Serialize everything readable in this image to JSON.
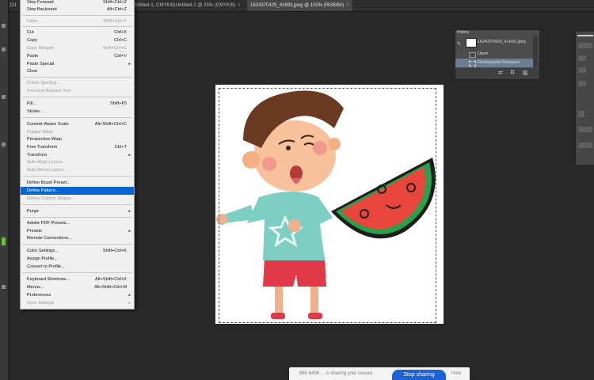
{
  "tabs": [
    {
      "label": "Untitled-1, CMYK/8)",
      "close": "×"
    },
    {
      "label": "Untitled-2 @ 25% (CMYK/8)",
      "close": "×"
    },
    {
      "label": "1624370429_41692.jpeg @ 100% (RGB/8#)",
      "close": "×"
    }
  ],
  "tab_left_fragment": "111",
  "edit_menu": {
    "items": [
      {
        "label": "Step Forward",
        "shortcut": "Shift+Ctrl+Z",
        "disabled": false
      },
      {
        "label": "Step Backward",
        "shortcut": "Alt+Ctrl+Z",
        "disabled": false
      },
      {
        "label": "Fade...",
        "shortcut": "Shift+Ctrl+F",
        "disabled": true
      },
      {
        "label": "Cut",
        "shortcut": "Ctrl+X",
        "disabled": false
      },
      {
        "label": "Copy",
        "shortcut": "Ctrl+C",
        "disabled": false
      },
      {
        "label": "Copy Merged",
        "shortcut": "Shift+Ctrl+C",
        "disabled": true
      },
      {
        "label": "Paste",
        "shortcut": "Ctrl+V",
        "disabled": false
      },
      {
        "label": "Paste Special",
        "shortcut": "",
        "disabled": false,
        "submenu": true
      },
      {
        "label": "Clear",
        "shortcut": "",
        "disabled": false
      },
      {
        "label": "Check Spelling...",
        "shortcut": "",
        "disabled": true
      },
      {
        "label": "Find and Replace Text...",
        "shortcut": "",
        "disabled": true
      },
      {
        "label": "Fill...",
        "shortcut": "Shift+F5",
        "disabled": false
      },
      {
        "label": "Stroke...",
        "shortcut": "",
        "disabled": false
      },
      {
        "label": "Content-Aware Scale",
        "shortcut": "Alt+Shift+Ctrl+C",
        "disabled": false
      },
      {
        "label": "Puppet Warp",
        "shortcut": "",
        "disabled": true
      },
      {
        "label": "Perspective Warp",
        "shortcut": "",
        "disabled": false
      },
      {
        "label": "Free Transform",
        "shortcut": "Ctrl+T",
        "disabled": false
      },
      {
        "label": "Transform",
        "shortcut": "",
        "disabled": false,
        "submenu": true
      },
      {
        "label": "Auto-Align Layers...",
        "shortcut": "",
        "disabled": true
      },
      {
        "label": "Auto-Blend Layers...",
        "shortcut": "",
        "disabled": true
      },
      {
        "label": "Define Brush Preset...",
        "shortcut": "",
        "disabled": false
      },
      {
        "label": "Define Pattern...",
        "shortcut": "",
        "disabled": false,
        "highlighted": true
      },
      {
        "label": "Define Custom Shape...",
        "shortcut": "",
        "disabled": true
      },
      {
        "label": "Purge",
        "shortcut": "",
        "disabled": false,
        "submenu": true
      },
      {
        "label": "Adobe PDF Presets...",
        "shortcut": "",
        "disabled": false
      },
      {
        "label": "Presets",
        "shortcut": "",
        "disabled": false,
        "submenu": true
      },
      {
        "label": "Remote Connections...",
        "shortcut": "",
        "disabled": false
      },
      {
        "label": "Color Settings...",
        "shortcut": "Shift+Ctrl+K",
        "disabled": false
      },
      {
        "label": "Assign Profile...",
        "shortcut": "",
        "disabled": false
      },
      {
        "label": "Convert to Profile...",
        "shortcut": "",
        "disabled": false
      },
      {
        "label": "Keyboard Shortcuts...",
        "shortcut": "Alt+Shift+Ctrl+K",
        "disabled": false
      },
      {
        "label": "Menus...",
        "shortcut": "Alt+Shift+Ctrl+M",
        "disabled": false
      },
      {
        "label": "Preferences",
        "shortcut": "",
        "disabled": false,
        "submenu": true
      },
      {
        "label": "Sync Settings",
        "shortcut": "",
        "disabled": true,
        "submenu": true
      }
    ],
    "submenu_arrow": "▸"
  },
  "history_panel": {
    "title": "History",
    "snapshot_label": "1624370429_41692.jpeg",
    "steps": [
      "Open",
      "Rectangular Marquee"
    ]
  },
  "notification": {
    "text": "885 6406 ... is sharing your screen.",
    "button_label": "Stop sharing",
    "more_label": "Hide"
  },
  "colors": {
    "menu_highlight": "#0a64d2",
    "watermelon_red": "#e8453c",
    "watermelon_green": "#2aa04a",
    "shirt": "#7ccfc2",
    "shorts": "#e03a4a",
    "hair": "#6a3b22"
  }
}
